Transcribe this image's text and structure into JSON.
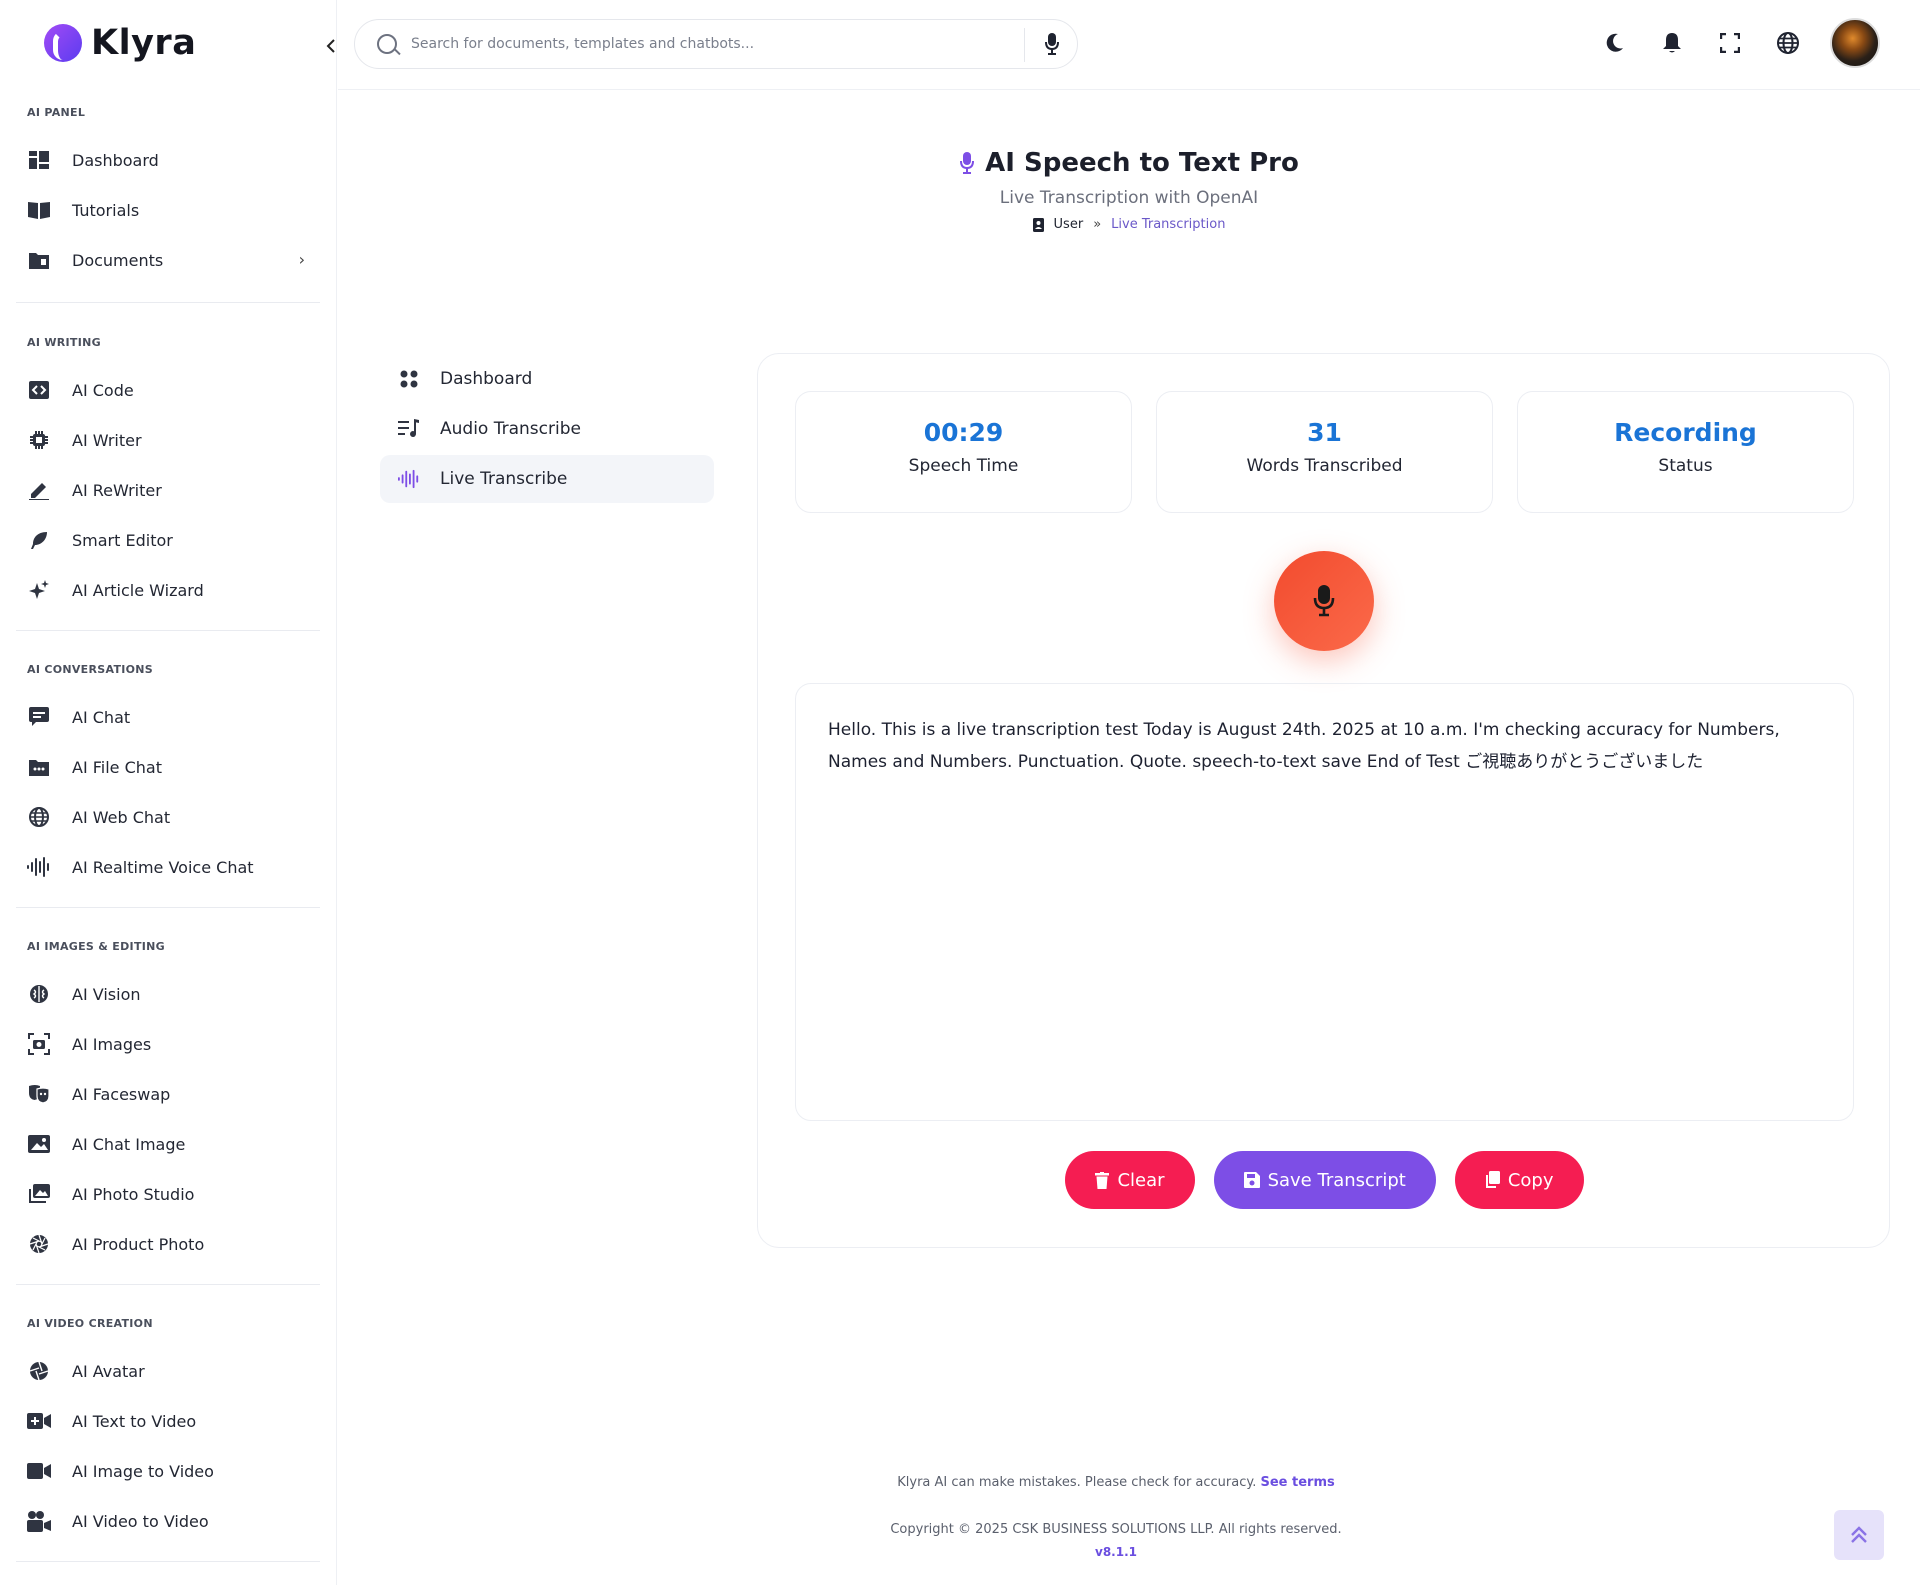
{
  "app": {
    "name": "Klyra"
  },
  "search": {
    "placeholder": "Search for documents, templates and chatbots..."
  },
  "sidebar": {
    "sections": [
      {
        "title": "AI PANEL",
        "items": [
          "Dashboard",
          "Tutorials",
          "Documents"
        ]
      },
      {
        "title": "AI WRITING",
        "items": [
          "AI Code",
          "AI Writer",
          "AI ReWriter",
          "Smart Editor",
          "AI Article Wizard"
        ]
      },
      {
        "title": "AI CONVERSATIONS",
        "items": [
          "AI Chat",
          "AI File Chat",
          "AI Web Chat",
          "AI Realtime Voice Chat"
        ]
      },
      {
        "title": "AI IMAGES & EDITING",
        "items": [
          "AI Vision",
          "AI Images",
          "AI Faceswap",
          "AI Chat Image",
          "AI Photo Studio",
          "AI Product Photo"
        ]
      },
      {
        "title": "AI VIDEO CREATION",
        "items": [
          "AI Avatar",
          "AI Text to Video",
          "AI Image to Video",
          "AI Video to Video"
        ]
      }
    ]
  },
  "header": {
    "title": "AI Speech to Text Pro",
    "subtitle": "Live Transcription with OpenAI",
    "breadcrumb": {
      "user": "User",
      "separator": "»",
      "current": "Live Transcription"
    }
  },
  "subnav": {
    "items": [
      "Dashboard",
      "Audio Transcribe",
      "Live Transcribe"
    ],
    "active": "Live Transcribe"
  },
  "stats": {
    "speech_time": {
      "value": "00:29",
      "label": "Speech Time"
    },
    "words": {
      "value": "31",
      "label": "Words Transcribed"
    },
    "status": {
      "value": "Recording",
      "label": "Status"
    }
  },
  "transcript": {
    "text": "Hello. This is a live transcription test Today is August 24th. 2025 at 10 a.m. I'm checking accuracy for Numbers, Names and Numbers. Punctuation. Quote. speech-to-text save End of Test ご視聴ありがとうございました"
  },
  "actions": {
    "clear": "Clear",
    "save": "Save Transcript",
    "copy": "Copy"
  },
  "footer": {
    "disclaimer": "Klyra AI can make mistakes. Please check for accuracy.",
    "terms": "See terms",
    "copyright": "Copyright © 2025 CSK BUSINESS SOLUTIONS LLP. All rights reserved.",
    "version": "v8.1.1"
  },
  "colors": {
    "accent": "#7d4ee6",
    "stat_value": "#1a74d6",
    "danger": "#f51d52",
    "record": "#f24b2e"
  },
  "icons": {
    "top": [
      "moon-icon",
      "bell-icon",
      "fullscreen-icon",
      "globe-icon"
    ]
  }
}
